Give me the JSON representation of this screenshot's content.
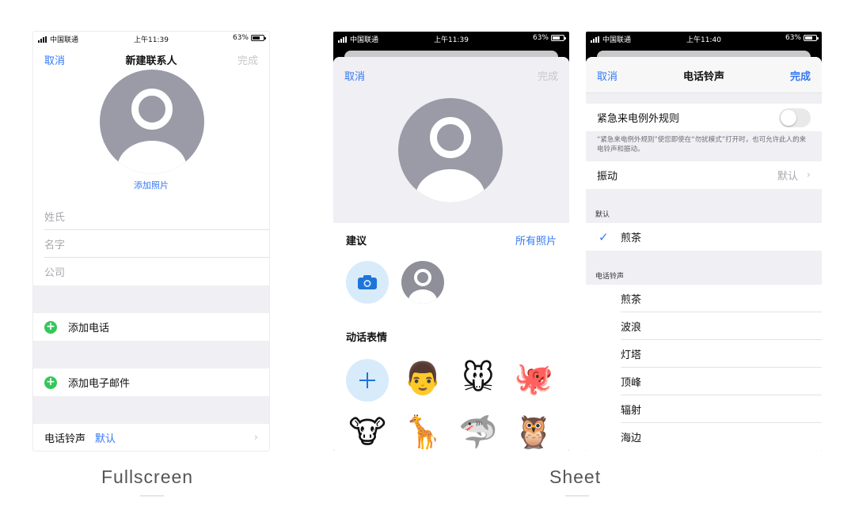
{
  "status": {
    "carrier": "中国联通",
    "time_1": "上午11:39",
    "time_2": "上午11:39",
    "time_3": "上午11:40",
    "battery": "63%"
  },
  "fullscreen": {
    "cancel": "取消",
    "title": "新建联系人",
    "done": "完成",
    "add_photo": "添加照片",
    "fields": [
      "姓氏",
      "名字",
      "公司"
    ],
    "add_phone": "添加电话",
    "add_email": "添加电子邮件",
    "ringtone_label": "电话铃声",
    "ringtone_value": "默认"
  },
  "sheet": {
    "cancel": "取消",
    "done": "完成",
    "suggestions": "建议",
    "all_photos": "所有照片",
    "animoji": "动话表情",
    "emojis_row1": [
      "👨",
      "🐭",
      "🐙"
    ],
    "emojis_row2": [
      "🐮",
      "🦒",
      "🦈",
      "🦉"
    ]
  },
  "ringtone": {
    "cancel": "取消",
    "title": "电话铃声",
    "done": "完成",
    "emergency_label": "紧急来电例外规则",
    "emergency_note": "“紧急来电例外规则”使您即使在“勿扰模式”打开时，也可允许此人的来电铃声和振动。",
    "vibration_label": "振动",
    "vibration_value": "默认",
    "default_header": "默认",
    "selected": "煎茶",
    "ringtones_header": "电话铃声",
    "ringtones": [
      "煎茶",
      "波浪",
      "灯塔",
      "顶峰",
      "辐射",
      "海边"
    ]
  },
  "captions": {
    "left": "Fullscreen",
    "right": "Sheet"
  },
  "colors": {
    "accent": "#3478f6",
    "green": "#34c759",
    "group_bg": "#efeff4",
    "avatar_gray": "#9a9ba6"
  }
}
